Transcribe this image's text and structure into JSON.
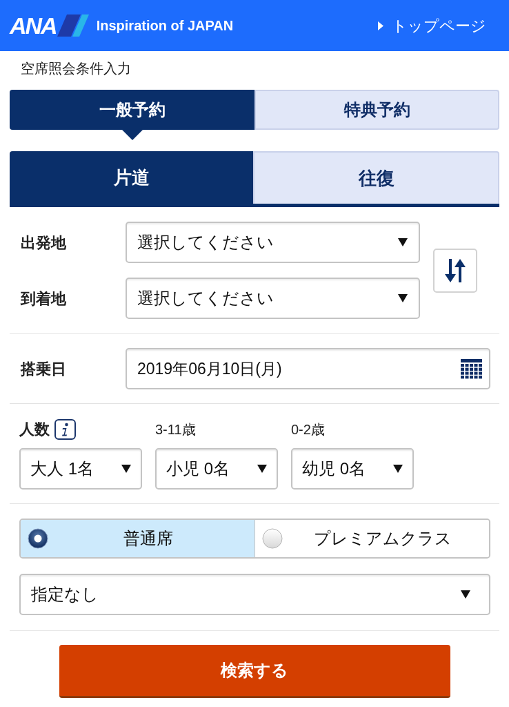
{
  "header": {
    "logo_text": "ANA",
    "tagline": "Inspiration of JAPAN",
    "top_link": "トップページ"
  },
  "page_title": "空席照会条件入力",
  "booking_tabs": [
    {
      "label": "一般予約",
      "selected": true
    },
    {
      "label": "特典予約",
      "selected": false
    }
  ],
  "trip_tabs": [
    {
      "label": "片道",
      "selected": true
    },
    {
      "label": "往復",
      "selected": false
    }
  ],
  "route": {
    "fields": [
      {
        "label": "出発地",
        "value": "選択してください"
      },
      {
        "label": "到着地",
        "value": "選択してください"
      }
    ]
  },
  "date": {
    "label": "搭乗日",
    "value": "2019年06月10日(月)"
  },
  "passengers": {
    "label": "人数",
    "selects": [
      {
        "value": "大人 1名"
      },
      {
        "caption": "3-11歳",
        "value": "小児 0名"
      },
      {
        "caption": "0-2歳",
        "value": "幼児 0名"
      }
    ]
  },
  "cabin_class": {
    "options": [
      {
        "label": "普通席",
        "selected": true
      },
      {
        "label": "プレミアムクラス",
        "selected": false
      }
    ]
  },
  "seat_filter": {
    "value": "指定なし"
  },
  "search_button": "検索する"
}
